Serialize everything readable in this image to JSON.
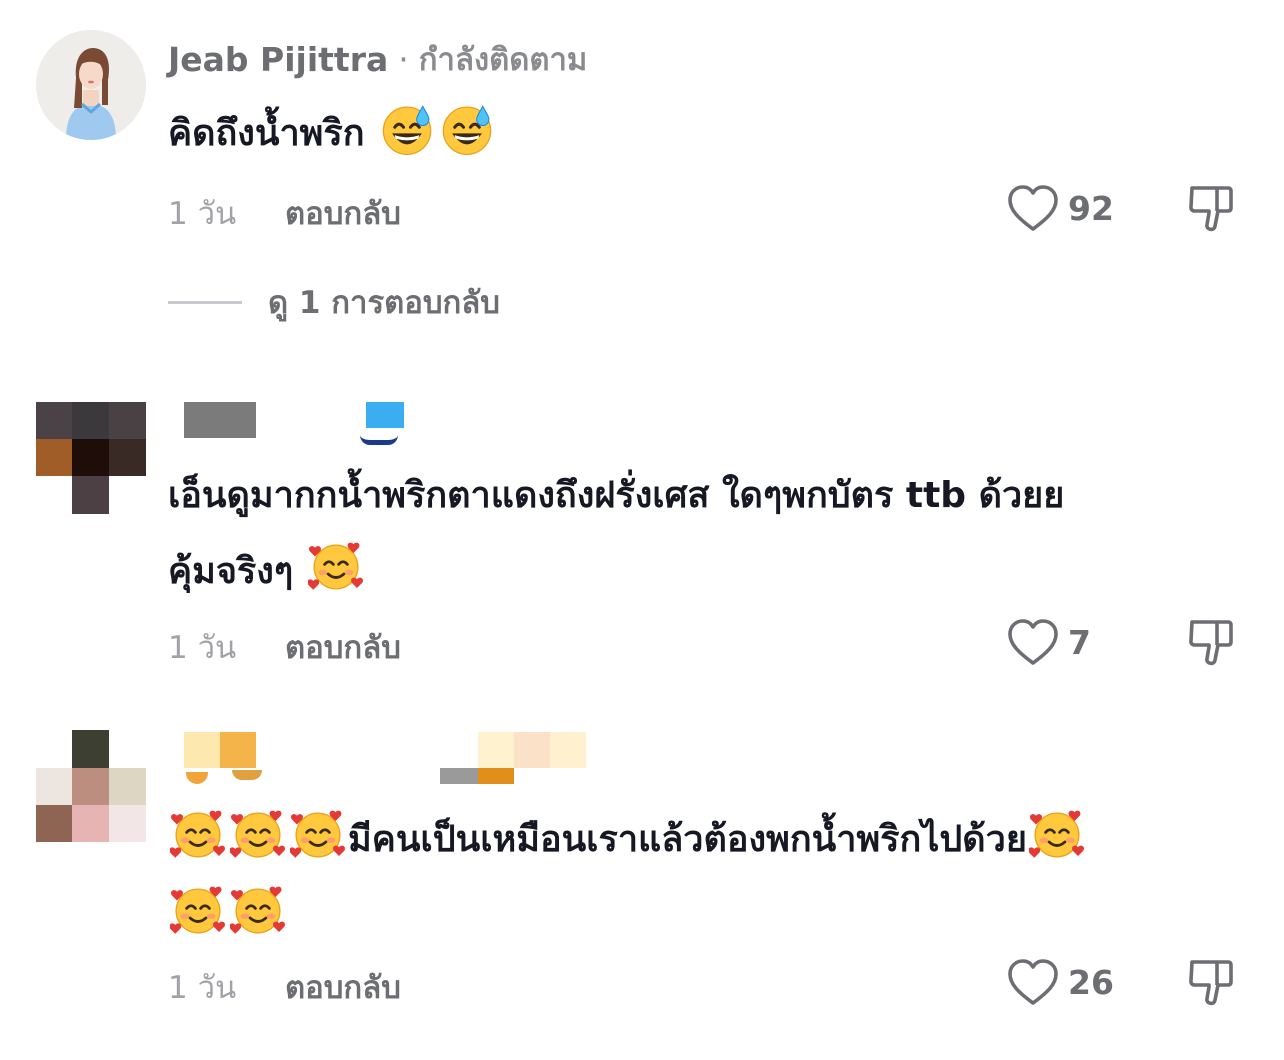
{
  "comments": [
    {
      "author": "Jeab Pijittra",
      "separator": "·",
      "follow_status": "กำลังติดตาม",
      "text": "คิดถึงน้ำพริก",
      "emojis_after": [
        "grinning-sweat",
        "grinning-sweat"
      ],
      "time": "1 วัน",
      "reply_label": "ตอบกลับ",
      "likes": "92",
      "view_replies": "ดู 1 การตอบกลับ"
    },
    {
      "author": "",
      "text_line1": "เอ็นดูมากกน้ำพริกตาแดงถึงฝรั่งเศส ใดๆพกบัตร ttb ด้วยย",
      "text_line2": "คุ้มจริงๆ",
      "emojis_after": [
        "smiling-hearts"
      ],
      "time": "1 วัน",
      "reply_label": "ตอบกลับ",
      "likes": "7"
    },
    {
      "author": "",
      "text_line1": "มีคนเป็นเหมือนเราแล้วต้องพกน้ำพริกไปด้วย",
      "emojis_before": [
        "smiling-hearts",
        "smiling-hearts",
        "smiling-hearts"
      ],
      "emojis_after_line1": [
        "smiling-hearts"
      ],
      "emojis_line2": [
        "smiling-hearts",
        "smiling-hearts"
      ],
      "time": "1 วัน",
      "reply_label": "ตอบกลับ",
      "likes": "26"
    }
  ],
  "colors": {
    "text_primary": "#161823",
    "text_secondary": "#6d6e72",
    "text_muted": "#a1a2a7",
    "emoji_face": "#ffc83d"
  },
  "icons": {
    "like": "heart-outline-icon",
    "dislike": "thumbs-down-outline-icon",
    "emoji_1": "grinning-face-with-sweat-emoji",
    "emoji_2": "smiling-face-with-hearts-emoji"
  }
}
